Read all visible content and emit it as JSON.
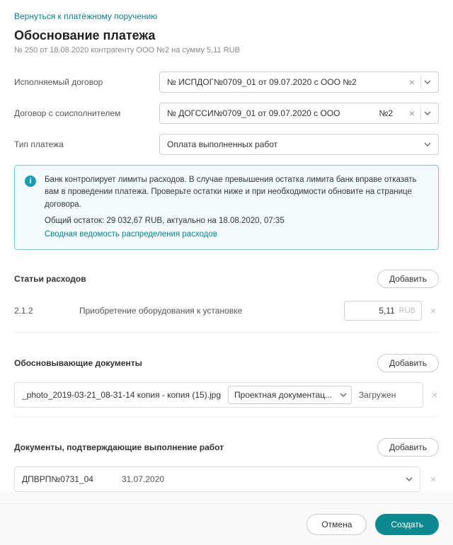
{
  "header": {
    "back_link": "Вернуться к платёжному поручению",
    "title": "Обоснование платежа",
    "subtitle": "№ 250 от 18.08.2020 контрагенту ООО №2 на сумму  5,11 RUB"
  },
  "fields": {
    "contract": {
      "label": "Исполняемый договор",
      "value": "№ ИСПДОГ№0709_01 от 09.07.2020 с ООО №2"
    },
    "subcontract": {
      "label": "Договор с соисполнителем",
      "value": "№ ДОГССИ№0709_01 от 09.07.2020 с ООО",
      "badge": "№2"
    },
    "payment_type": {
      "label": "Тип платежа",
      "value": "Оплата выполненных работ"
    }
  },
  "info": {
    "text": "Банк контролирует лимиты расходов. В случае превышения остатка лимита банк вправе отказать вам в проведении платежа. Проверьте остатки ниже и при необходимости обновите на странице договора.",
    "balance": "Общий остаток: 29 032,67 RUB, актуально на 18.08.2020, 07:35",
    "link": "Сводная ведомость распределения расходов"
  },
  "expenses": {
    "title": "Статьи расходов",
    "add_label": "Добавить",
    "items": [
      {
        "code": "2.1.2",
        "desc": "Приобретение оборудования к установке",
        "amount": "5,11",
        "currency": "RUB"
      }
    ]
  },
  "docs": {
    "title": "Обосновывающие документы",
    "add_label": "Добавить",
    "items": [
      {
        "name": "_photo_2019-03-21_08-31-14 копия - копия (15).jpg",
        "type": "Проектная документац...",
        "status": "Загружен"
      }
    ]
  },
  "confirm": {
    "title": "Документы, подтверждающие выполнение работ",
    "add_label": "Добавить",
    "items": [
      {
        "code": "ДПВРП№0731_04",
        "date": "31.07.2020"
      }
    ]
  },
  "footer": {
    "cancel": "Отмена",
    "create": "Создать"
  }
}
